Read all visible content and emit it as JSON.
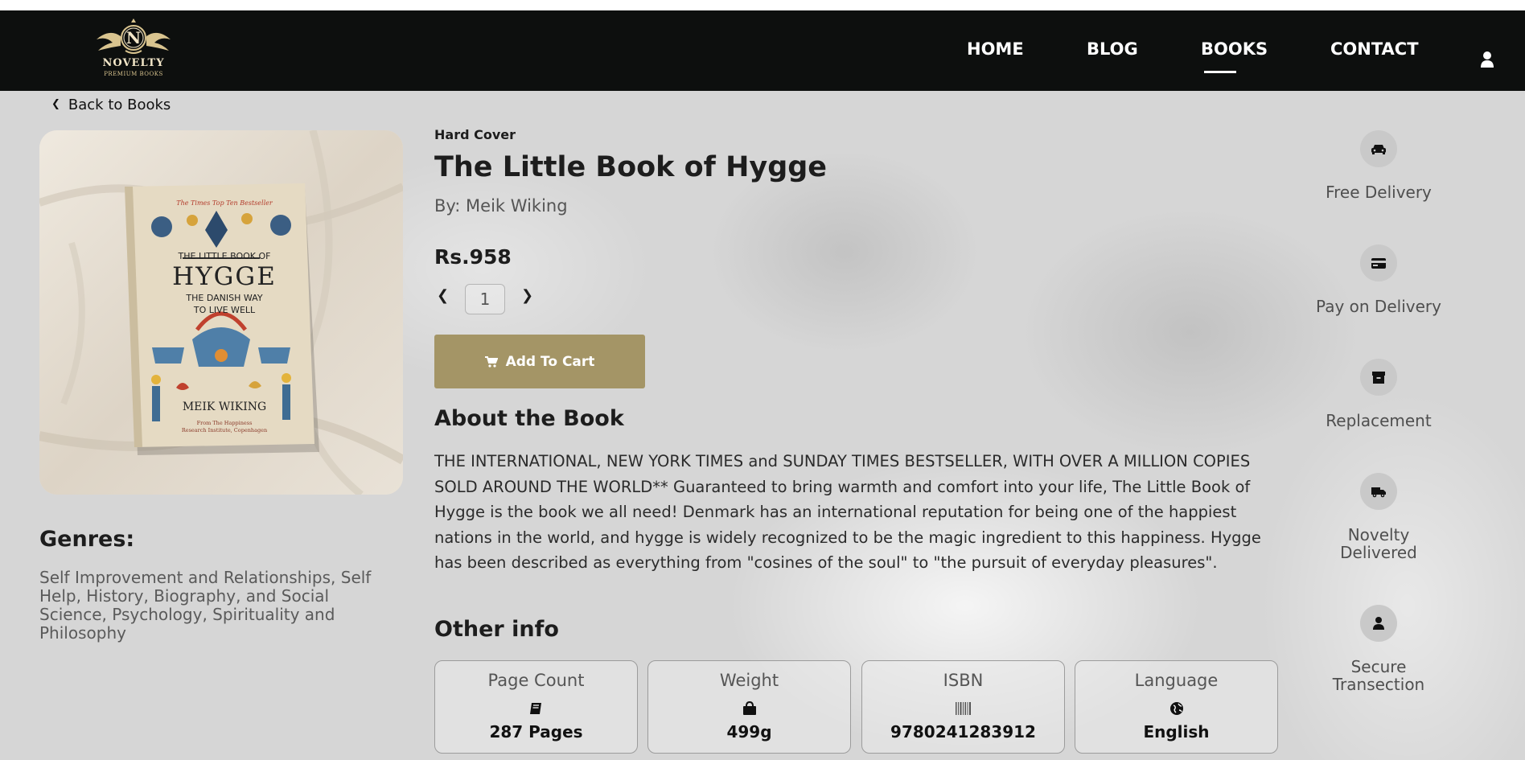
{
  "brand": {
    "logo_letter": "N",
    "name": "NOVELTY",
    "tagline": "PREMIUM BOOKS"
  },
  "nav": {
    "home": "HOME",
    "blog": "BLOG",
    "books": "BOOKS",
    "contact": "CONTACT",
    "active": "BOOKS",
    "account_icon": "user-icon"
  },
  "back": {
    "label": "Back to Books"
  },
  "book": {
    "format": "Hard Cover",
    "title": "The Little Book of Hygge",
    "author": "By: Meik Wiking",
    "price": "Rs.958",
    "quantity": "1",
    "add_to_cart": "Add To Cart",
    "cover": {
      "banner": "The Times Top Ten Bestseller",
      "line1": "THE LITTLE BOOK OF",
      "line2": "HYGGE",
      "line3": "THE DANISH WAY",
      "line4": "TO LIVE WELL",
      "author": "MEIK WIKING",
      "footer1": "From The Happiness",
      "footer2": "Research Institute, Copenhagen"
    }
  },
  "genres": {
    "title": "Genres:",
    "text": "Self Improvement and Relationships, Self Help, History, Biography, and Social Science, Psychology, Spirituality and Philosophy"
  },
  "about": {
    "title": "About the Book",
    "text": "THE INTERNATIONAL, NEW YORK TIMES and SUNDAY TIMES BESTSELLER, WITH OVER A MILLION COPIES SOLD AROUND THE WORLD** Guaranteed to bring warmth and comfort into your life, The Little Book of Hygge is the book we all need! Denmark has an international reputation for being one of the happiest nations in the world, and hygge is widely recognized to be the magic ingredient to this happiness. Hygge has been described as everything from \"cosines of the soul\" to \"the pursuit of everyday pleasures\"."
  },
  "other_info": {
    "title": "Other info",
    "cards": [
      {
        "label": "Page Count",
        "value": "287 Pages",
        "icon": "book-icon"
      },
      {
        "label": "Weight",
        "value": "499g",
        "icon": "bag-icon"
      },
      {
        "label": "ISBN",
        "value": "9780241283912",
        "icon": "barcode-icon"
      },
      {
        "label": "Language",
        "value": "English",
        "icon": "globe-icon"
      }
    ]
  },
  "features": [
    {
      "label": "Free Delivery",
      "icon": "car-icon"
    },
    {
      "label": "Pay on Delivery",
      "icon": "credit-card-icon"
    },
    {
      "label": "Replacement",
      "icon": "archive-box-icon"
    },
    {
      "label": "Novelty Delivered",
      "icon": "truck-icon"
    },
    {
      "label": "Secure Transection",
      "icon": "user-shield-icon"
    }
  ],
  "colors": {
    "navbar": "#0d0f0e",
    "accent": "#a49566",
    "background": "#d6d6d6"
  }
}
